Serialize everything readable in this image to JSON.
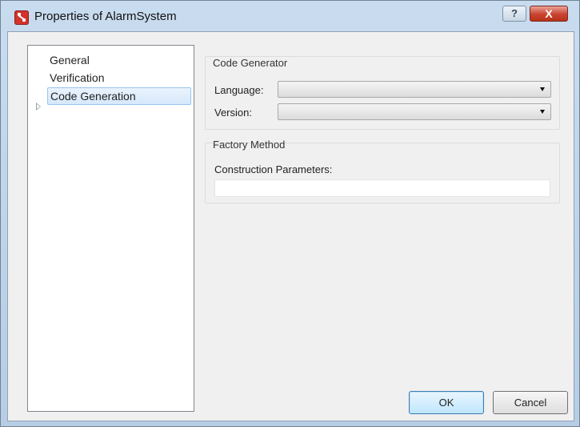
{
  "window": {
    "title": "Properties of AlarmSystem",
    "help_label": "?",
    "close_label": "X"
  },
  "nav": {
    "items": [
      {
        "label": "General"
      },
      {
        "label": "Verification"
      },
      {
        "label": "Code Generation",
        "selected": true,
        "expandable": true
      }
    ]
  },
  "code_generator": {
    "title": "Code Generator",
    "language_label": "Language:",
    "language_value": "",
    "version_label": "Version:",
    "version_value": ""
  },
  "factory_method": {
    "title": "Factory Method",
    "construction_label": "Construction Parameters:",
    "construction_value": ""
  },
  "buttons": {
    "ok": "OK",
    "cancel": "Cancel"
  },
  "colors": {
    "selection": "#d6e8fb",
    "close_button": "#c9432f",
    "default_button": "#bee6fd"
  },
  "icons": [
    "app-icon",
    "help-icon",
    "close-icon",
    "expander-triangle-icon",
    "dropdown-arrow-icon"
  ]
}
